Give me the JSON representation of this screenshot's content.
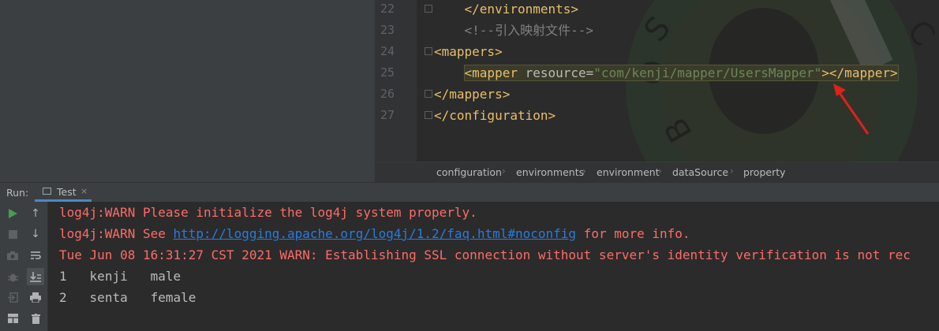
{
  "editor": {
    "lines": [
      {
        "num": "22",
        "text": "    </environments>"
      },
      {
        "num": "23",
        "comment": "<!--引入映射文件-->"
      },
      {
        "num": "24",
        "text": "<mappers>"
      },
      {
        "num": "25",
        "tag_open": "<mapper ",
        "attr": "resource",
        "eq": "=",
        "value": "\"com/kenji/mapper/UsersMapper\"",
        "tag_close": "></mapper>"
      },
      {
        "num": "26",
        "text": "</mappers>"
      },
      {
        "num": "27",
        "text": "</configuration>"
      }
    ]
  },
  "breadcrumbs": [
    "configuration",
    "environments",
    "environment",
    "dataSource",
    "property"
  ],
  "run_panel": {
    "label": "Run:",
    "tab": "Test",
    "close": "×"
  },
  "console": {
    "warn1": "log4j:WARN Please initialize the log4j system properly.",
    "warn2_prefix": "log4j:WARN See ",
    "warn2_link": "http://logging.apache.org/log4j/1.2/faq.html#noconfig",
    "warn2_suffix": " for more info.",
    "warn3": "Tue Jun 08 16:31:27 CST 2021 WARN: Establishing SSL connection without server's identity verification is not rec",
    "rows": [
      {
        "id": "1",
        "name": "kenji",
        "gender": "male"
      },
      {
        "id": "2",
        "name": "senta",
        "gender": "female"
      }
    ]
  },
  "toolbar_icons": [
    "run-icon",
    "up-arrow-icon",
    "stop-icon",
    "down-arrow-icon",
    "camera-icon",
    "soft-wrap-icon",
    "debug-icon",
    "scroll-to-end-icon",
    "exit-icon",
    "print-icon",
    "layout-icon",
    "trash-icon"
  ],
  "colors": {
    "error": "#ff6b68",
    "link": "#287bde",
    "tag": "#e8bf6a",
    "string": "#6a8759",
    "run": "#499c54"
  }
}
